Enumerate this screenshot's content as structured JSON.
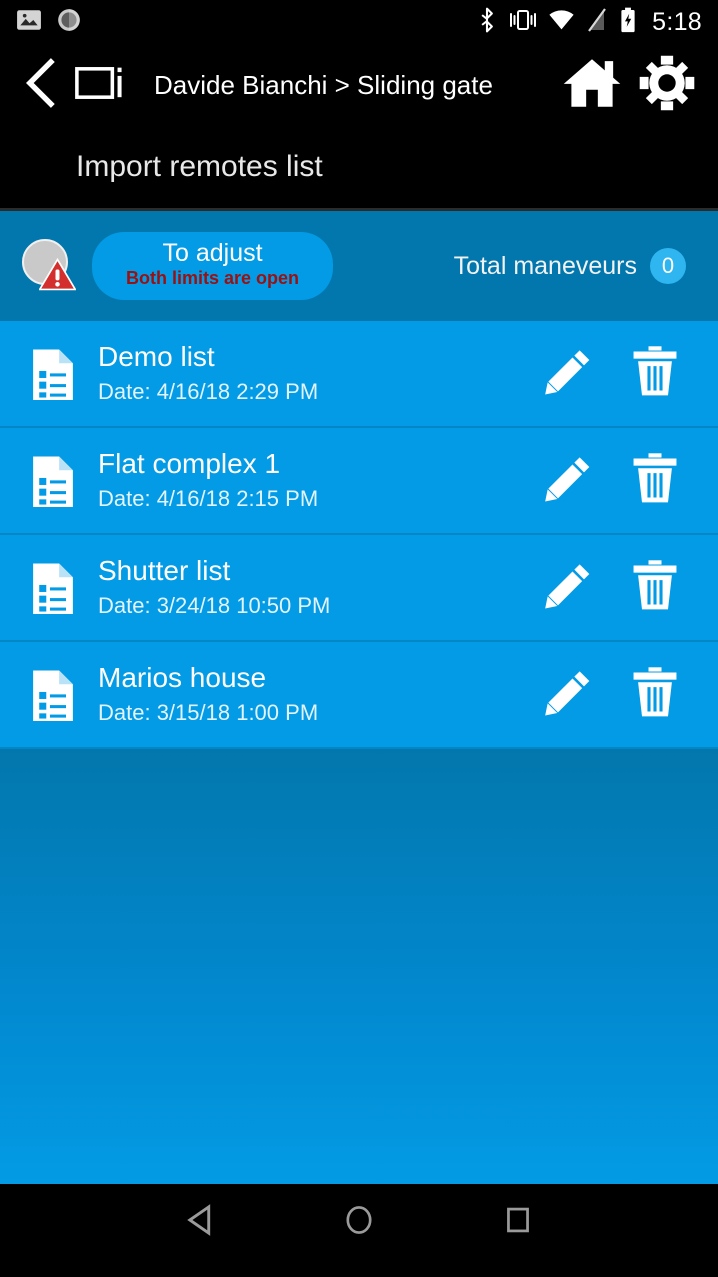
{
  "status_bar": {
    "icons_left": [
      "photo-icon",
      "brightness-icon"
    ],
    "icons_right": [
      "bluetooth-icon",
      "vibrate-icon",
      "wifi-icon",
      "no-signal-icon",
      "battery-charging-icon"
    ],
    "clock": "5:18"
  },
  "app_bar": {
    "back_icon": "back-chevron-icon",
    "device_icon": "device-info-icon",
    "breadcrumb": "Davide Bianchi > Sliding gate",
    "home_icon": "home-icon",
    "settings_icon": "gear-icon"
  },
  "page": {
    "title": "Import remotes list"
  },
  "status_strip": {
    "warning_icon": "warning-triangle-icon",
    "pill_main": "To adjust",
    "pill_sub": "Both limits are open",
    "maneuvers_label": "Total maneveurs",
    "maneuvers_count": "0"
  },
  "list": {
    "items": [
      {
        "icon": "document-list-icon",
        "title": "Demo list",
        "date": "Date: 4/16/18 2:29 PM",
        "edit_icon": "pencil-icon",
        "delete_icon": "trash-icon"
      },
      {
        "icon": "document-list-icon",
        "title": "Flat complex 1",
        "date": "Date: 4/16/18 2:15 PM",
        "edit_icon": "pencil-icon",
        "delete_icon": "trash-icon"
      },
      {
        "icon": "document-list-icon",
        "title": "Shutter list",
        "date": "Date: 3/24/18 10:50 PM",
        "edit_icon": "pencil-icon",
        "delete_icon": "trash-icon"
      },
      {
        "icon": "document-list-icon",
        "title": "Marios house",
        "date": "Date: 3/15/18 1:00 PM",
        "edit_icon": "pencil-icon",
        "delete_icon": "trash-icon"
      }
    ]
  },
  "nav_bar": {
    "back_icon": "nav-back-triangle-icon",
    "home_icon": "nav-home-circle-icon",
    "recents_icon": "nav-recents-square-icon"
  },
  "colors": {
    "accent_blue": "#039BE5",
    "strip_blue": "#0277AD",
    "badge_blue": "#2FB6F0",
    "warning_red": "#D32F2F",
    "alert_text_red": "#9B1111",
    "bar_black": "#000000"
  }
}
